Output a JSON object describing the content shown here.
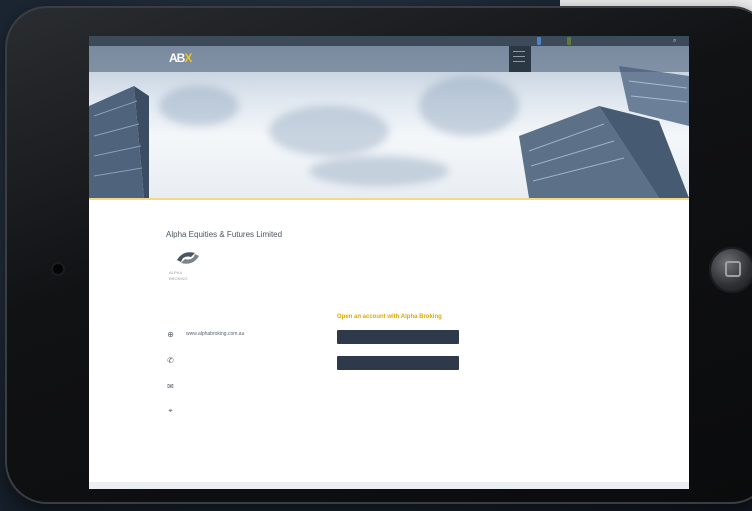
{
  "colors": {
    "topbar": "#3d4a5a",
    "accent_gold": "#e0a800",
    "button_dark": "#2e3a4a",
    "nav_active": "#f0c419"
  },
  "topbar": {
    "left_label": "",
    "tagline": "",
    "items": [
      "",
      "",
      "",
      ""
    ],
    "blue_button": "",
    "green_button": "",
    "search_icon": "search-icon"
  },
  "nav": {
    "logo_main": "AB",
    "logo_accent": "X",
    "items": [
      {
        "label": ""
      },
      {
        "label": ""
      },
      {
        "label": ""
      },
      {
        "label": ""
      },
      {
        "label": ""
      }
    ]
  },
  "breadcrumb": "",
  "page": {
    "title": "Alpha Equities & Futures Limited"
  },
  "partner": {
    "name": "ALPHA\nBROKING"
  },
  "contact": {
    "website": "www.alphabroking.com.au",
    "phone": "",
    "email": "",
    "address": ""
  },
  "cta": {
    "heading": "Open an account with Alpha Broking",
    "button_primary": "",
    "button_secondary": ""
  },
  "disclaimer": ""
}
